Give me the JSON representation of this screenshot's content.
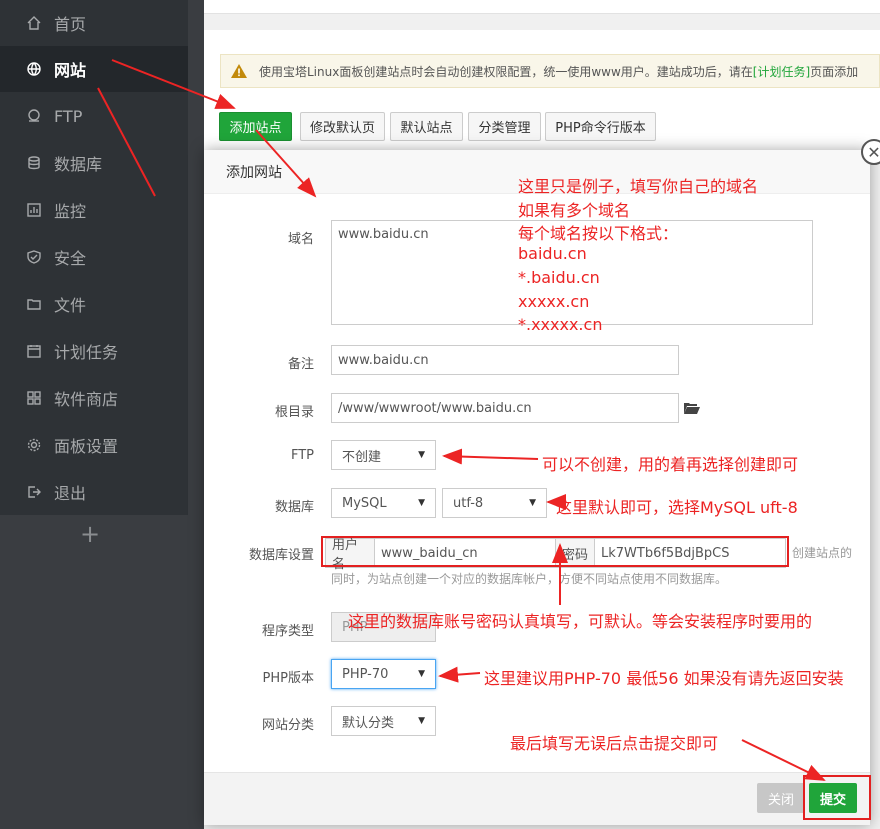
{
  "sidebar": {
    "items": [
      {
        "label": "首页",
        "icon": "home-icon"
      },
      {
        "label": "网站",
        "icon": "globe-icon"
      },
      {
        "label": "FTP",
        "icon": "ftp-icon"
      },
      {
        "label": "数据库",
        "icon": "database-icon"
      },
      {
        "label": "监控",
        "icon": "monitor-icon"
      },
      {
        "label": "安全",
        "icon": "shield-icon"
      },
      {
        "label": "文件",
        "icon": "folder-icon"
      },
      {
        "label": "计划任务",
        "icon": "calendar-icon"
      },
      {
        "label": "软件商店",
        "icon": "grid-icon"
      },
      {
        "label": "面板设置",
        "icon": "gear-icon"
      },
      {
        "label": "退出",
        "icon": "logout-icon"
      }
    ],
    "add": "+"
  },
  "notice": {
    "text": "使用宝塔Linux面板创建站点时会自动创建权限配置，统一使用www用户。建站成功后，请在",
    "link": "[计划任务]",
    "tail": "页面添加"
  },
  "toolbar": {
    "add_site": "添加站点",
    "edit_default_page": "修改默认页",
    "default_site": "默认站点",
    "category_manage": "分类管理",
    "php_cli_version": "PHP命令行版本"
  },
  "modal": {
    "title": "添加网站",
    "domain_label": "域名",
    "domain_value": "www.baidu.cn",
    "remark_label": "备注",
    "remark_value": "www.baidu.cn",
    "root_label": "根目录",
    "root_value": "/www/wwwroot/www.baidu.cn",
    "ftp_label": "FTP",
    "ftp_value": "不创建",
    "db_label": "数据库",
    "db_type": "MySQL",
    "db_charset": "utf-8",
    "db_settings_label": "数据库设置",
    "db_user_label": "用户名",
    "db_user_value": "www_baidu_cn",
    "db_pass_label": "密码",
    "db_pass_value": "Lk7WTb6f5BdjBpCS",
    "db_hint_right": "创建站点的",
    "db_hint_line2": "同时，为站点创建一个对应的数据库帐户，方便不同站点使用不同数据库。",
    "program_label": "程序类型",
    "program_value": "PHP",
    "php_label": "PHP版本",
    "php_value": "PHP-70",
    "category_label": "网站分类",
    "category_value": "默认分类",
    "close_btn": "关闭",
    "submit_btn": "提交"
  },
  "annotations": {
    "domain_note": [
      "这里只是例子，填写你自己的域名",
      "如果有多个域名",
      "每个域名按以下格式：",
      "baidu.cn",
      "*.baidu.cn",
      "xxxxx.cn",
      "*.xxxxx.cn"
    ],
    "ftp_note": "可以不创建，用的着再选择创建即可",
    "db_note": "这里默认即可，选择MySQL  uft-8",
    "dbset_note": "这里的数据库账号密码认真填写，可默认。等会安装程序时要用的",
    "php_note": "这里建议用PHP-70 最低56 如果没有请先返回安装",
    "submit_note": "最后填写无误后点击提交即可"
  },
  "colors": {
    "accent": "#20a53a",
    "annotation": "#ec2424",
    "sidebar": "#2e3236"
  }
}
